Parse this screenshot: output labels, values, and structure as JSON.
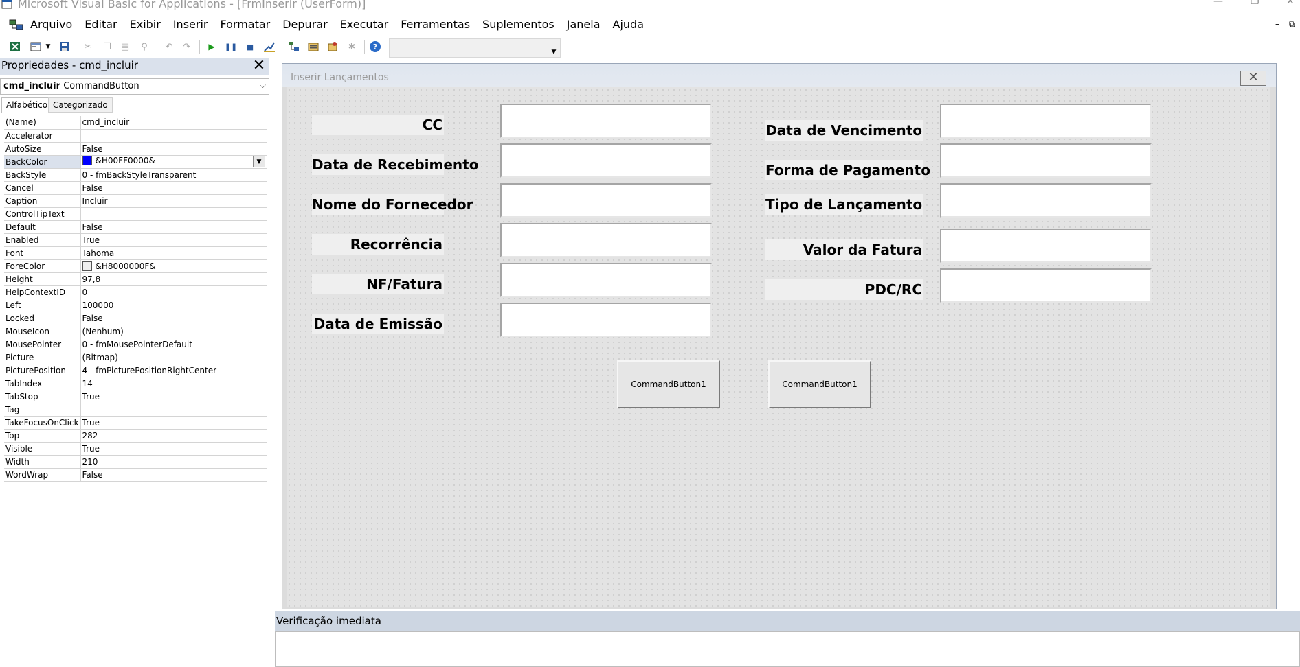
{
  "window": {
    "title": "Microsoft Visual Basic for Applications - [FrmInserir (UserForm)]",
    "minimize_glyph": "—",
    "restore_glyph": "❐",
    "close_glyph": "✕"
  },
  "menu": {
    "items": [
      "Arquivo",
      "Editar",
      "Exibir",
      "Inserir",
      "Formatar",
      "Depurar",
      "Executar",
      "Ferramentas",
      "Suplementos",
      "Janela",
      "Ajuda"
    ],
    "mdi_minimize": "–",
    "mdi_restore": "⧉"
  },
  "toolbar": {
    "icons": [
      "excel-icon",
      "insert-userform-icon",
      "dropdown-arrow-icon",
      "save-icon",
      "cut-icon",
      "copy-icon",
      "paste-icon",
      "find-icon",
      "undo-icon",
      "redo-icon",
      "run-icon",
      "break-icon",
      "reset-icon",
      "design-mode-icon",
      "project-explorer-icon",
      "properties-window-icon",
      "object-browser-icon",
      "toolbox-icon",
      "help-icon"
    ]
  },
  "properties_panel": {
    "title": "Propriedades - cmd_incluir",
    "close_glyph": "✕",
    "object_name": "cmd_incluir",
    "object_type": "CommandButton",
    "tabs": [
      "Alfabético",
      "Categorizado"
    ],
    "rows": [
      {
        "name": "(Name)",
        "value": "cmd_incluir"
      },
      {
        "name": "Accelerator",
        "value": ""
      },
      {
        "name": "AutoSize",
        "value": "False"
      },
      {
        "name": "BackColor",
        "value": "&H00FF0000&",
        "swatch": "#0000ff",
        "selected": true
      },
      {
        "name": "BackStyle",
        "value": "0 - fmBackStyleTransparent"
      },
      {
        "name": "Cancel",
        "value": "False"
      },
      {
        "name": "Caption",
        "value": "Incluir"
      },
      {
        "name": "ControlTipText",
        "value": ""
      },
      {
        "name": "Default",
        "value": "False"
      },
      {
        "name": "Enabled",
        "value": "True"
      },
      {
        "name": "Font",
        "value": "Tahoma"
      },
      {
        "name": "ForeColor",
        "value": "&H8000000F&",
        "swatch": "#f0f0f0"
      },
      {
        "name": "Height",
        "value": "97,8"
      },
      {
        "name": "HelpContextID",
        "value": "0"
      },
      {
        "name": "Left",
        "value": "100000"
      },
      {
        "name": "Locked",
        "value": "False"
      },
      {
        "name": "MouseIcon",
        "value": "(Nenhum)"
      },
      {
        "name": "MousePointer",
        "value": "0 - fmMousePointerDefault"
      },
      {
        "name": "Picture",
        "value": "(Bitmap)"
      },
      {
        "name": "PicturePosition",
        "value": "4 - fmPicturePositionRightCenter"
      },
      {
        "name": "TabIndex",
        "value": "14"
      },
      {
        "name": "TabStop",
        "value": "True"
      },
      {
        "name": "Tag",
        "value": ""
      },
      {
        "name": "TakeFocusOnClick",
        "value": "True"
      },
      {
        "name": "Top",
        "value": "282"
      },
      {
        "name": "Visible",
        "value": "True"
      },
      {
        "name": "Width",
        "value": "210"
      },
      {
        "name": "WordWrap",
        "value": "False"
      }
    ]
  },
  "userform": {
    "caption": "Inserir Lançamentos",
    "close_glyph": "✕",
    "left_labels": [
      "CC",
      "Data de Recebimento",
      "Nome do Fornecedor",
      "Recorrência",
      "NF/Fatura",
      "Data de Emissão"
    ],
    "right_labels": [
      "Data de Vencimento",
      "Forma de Pagamento",
      "Tipo de Lançamento",
      "Valor da Fatura",
      "PDC/RC"
    ],
    "buttons": [
      "CommandButton1",
      "CommandButton1"
    ]
  },
  "immediate_window": {
    "title": "Verificação imediata"
  }
}
